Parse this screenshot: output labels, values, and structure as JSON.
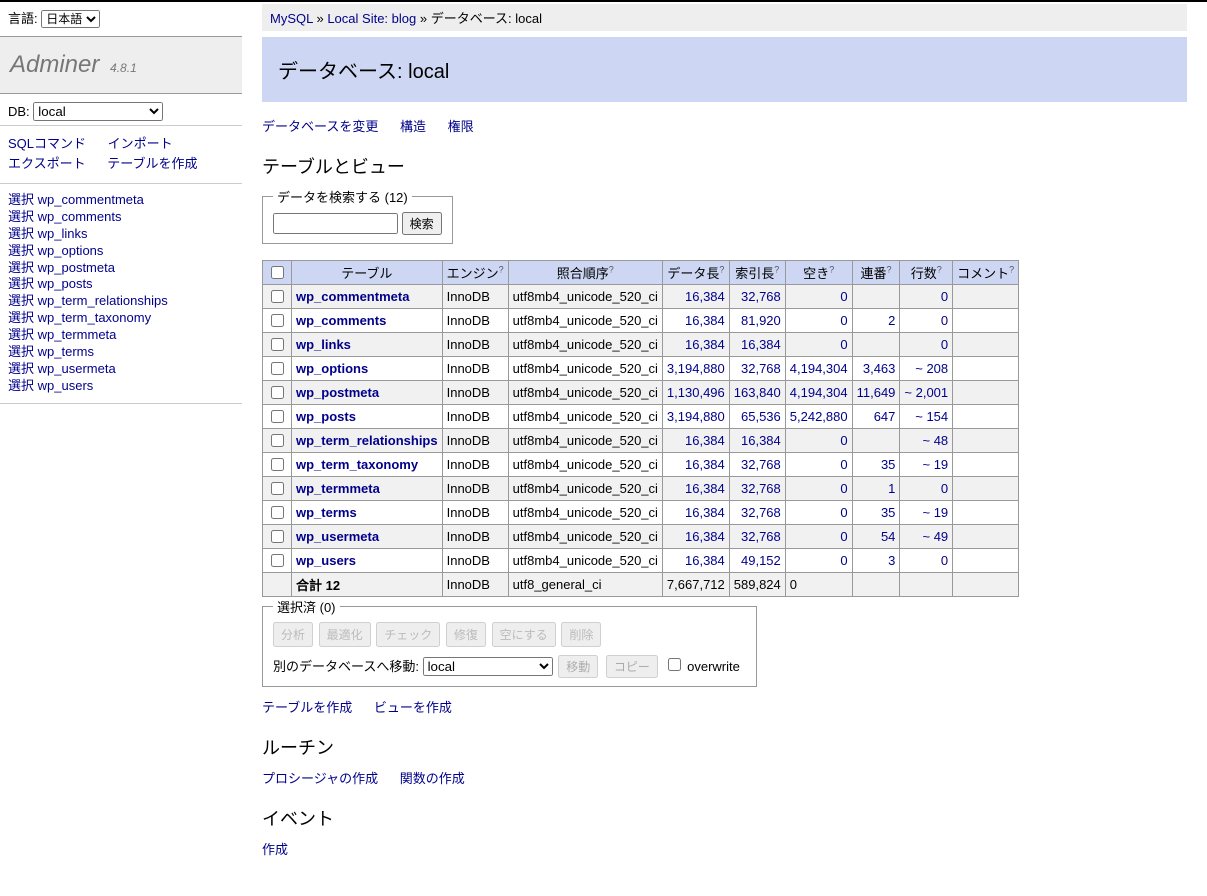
{
  "lang": {
    "label": "言語:",
    "selected": "日本語"
  },
  "logo": {
    "name": "Adminer",
    "version": "4.8.1"
  },
  "db": {
    "label": "DB:",
    "selected": "local"
  },
  "sideLinks": {
    "sqlcmd": "SQLコマンド",
    "import": "インポート",
    "export": "エクスポート",
    "createtable": "テーブルを作成"
  },
  "tablesSidebar": {
    "select": "選択"
  },
  "breadcrumb": {
    "a": "MySQL",
    "b": "Local Site: blog",
    "cLabel": "データベース: ",
    "cValue": "local"
  },
  "page": {
    "titlePrefix": "データベース: ",
    "titleDb": "local"
  },
  "dblinks": {
    "alter": "データベースを変更",
    "schema": "構造",
    "privs": "権限"
  },
  "sections": {
    "tables": "テーブルとビュー",
    "routines": "ルーチン",
    "events": "イベント"
  },
  "search": {
    "legend": "データを検索する (12)",
    "btn": "検索"
  },
  "headers": {
    "table": "テーブル",
    "engine": "エンジン",
    "collation": "照合順序",
    "datalen": "データ長",
    "indexlen": "索引長",
    "free": "空き",
    "autoinc": "連番",
    "rows": "行数",
    "comment": "コメント",
    "q": "?"
  },
  "rows": [
    {
      "name": "wp_commentmeta",
      "engine": "InnoDB",
      "coll": "utf8mb4_unicode_520_ci",
      "data": "16,384",
      "idx": "32,768",
      "free": "0",
      "auto": "",
      "rows": "0",
      "cmt": ""
    },
    {
      "name": "wp_comments",
      "engine": "InnoDB",
      "coll": "utf8mb4_unicode_520_ci",
      "data": "16,384",
      "idx": "81,920",
      "free": "0",
      "auto": "2",
      "rows": "0",
      "cmt": ""
    },
    {
      "name": "wp_links",
      "engine": "InnoDB",
      "coll": "utf8mb4_unicode_520_ci",
      "data": "16,384",
      "idx": "16,384",
      "free": "0",
      "auto": "",
      "rows": "0",
      "cmt": ""
    },
    {
      "name": "wp_options",
      "engine": "InnoDB",
      "coll": "utf8mb4_unicode_520_ci",
      "data": "3,194,880",
      "idx": "32,768",
      "free": "4,194,304",
      "auto": "3,463",
      "rows": "~ 208",
      "cmt": ""
    },
    {
      "name": "wp_postmeta",
      "engine": "InnoDB",
      "coll": "utf8mb4_unicode_520_ci",
      "data": "1,130,496",
      "idx": "163,840",
      "free": "4,194,304",
      "auto": "11,649",
      "rows": "~ 2,001",
      "cmt": ""
    },
    {
      "name": "wp_posts",
      "engine": "InnoDB",
      "coll": "utf8mb4_unicode_520_ci",
      "data": "3,194,880",
      "idx": "65,536",
      "free": "5,242,880",
      "auto": "647",
      "rows": "~ 154",
      "cmt": ""
    },
    {
      "name": "wp_term_relationships",
      "engine": "InnoDB",
      "coll": "utf8mb4_unicode_520_ci",
      "data": "16,384",
      "idx": "16,384",
      "free": "0",
      "auto": "",
      "rows": "~ 48",
      "cmt": ""
    },
    {
      "name": "wp_term_taxonomy",
      "engine": "InnoDB",
      "coll": "utf8mb4_unicode_520_ci",
      "data": "16,384",
      "idx": "32,768",
      "free": "0",
      "auto": "35",
      "rows": "~ 19",
      "cmt": ""
    },
    {
      "name": "wp_termmeta",
      "engine": "InnoDB",
      "coll": "utf8mb4_unicode_520_ci",
      "data": "16,384",
      "idx": "32,768",
      "free": "0",
      "auto": "1",
      "rows": "0",
      "cmt": ""
    },
    {
      "name": "wp_terms",
      "engine": "InnoDB",
      "coll": "utf8mb4_unicode_520_ci",
      "data": "16,384",
      "idx": "32,768",
      "free": "0",
      "auto": "35",
      "rows": "~ 19",
      "cmt": ""
    },
    {
      "name": "wp_usermeta",
      "engine": "InnoDB",
      "coll": "utf8mb4_unicode_520_ci",
      "data": "16,384",
      "idx": "32,768",
      "free": "0",
      "auto": "54",
      "rows": "~ 49",
      "cmt": ""
    },
    {
      "name": "wp_users",
      "engine": "InnoDB",
      "coll": "utf8mb4_unicode_520_ci",
      "data": "16,384",
      "idx": "49,152",
      "free": "0",
      "auto": "3",
      "rows": "0",
      "cmt": ""
    }
  ],
  "totals": {
    "label": "合計 12",
    "engine": "InnoDB",
    "coll": "utf8_general_ci",
    "data": "7,667,712",
    "idx": "589,824",
    "free": "0",
    "auto": "",
    "rows": "",
    "cmt": ""
  },
  "selected": {
    "legend": "選択済 (0)",
    "analyze": "分析",
    "optimize": "最適化",
    "check": "チェック",
    "repair": "修復",
    "truncate": "空にする",
    "drop": "削除",
    "moveLabel": "別のデータベースへ移動:",
    "moveDb": "local",
    "move": "移動",
    "copy": "コピー",
    "overwrite": "overwrite"
  },
  "bottomLinks": {
    "createTable": "テーブルを作成",
    "createView": "ビューを作成",
    "createProc": "プロシージャの作成",
    "createFunc": "関数の作成",
    "createEvent": "作成"
  }
}
